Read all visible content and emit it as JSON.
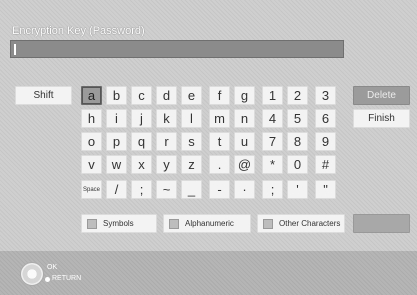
{
  "title": "Encryption Key (Password)",
  "keys": {
    "row1": [
      "a",
      "b",
      "c",
      "d",
      "e",
      "f",
      "g",
      "1",
      "2",
      "3"
    ],
    "row2": [
      "h",
      "i",
      "j",
      "k",
      "l",
      "m",
      "n",
      "4",
      "5",
      "6"
    ],
    "row3": [
      "o",
      "p",
      "q",
      "r",
      "s",
      "t",
      "u",
      "7",
      "8",
      "9"
    ],
    "row4": [
      "v",
      "w",
      "x",
      "y",
      "z",
      ".",
      "@",
      "*",
      "0",
      "#"
    ],
    "row5": [
      "Space",
      "/",
      ";",
      "~",
      "_",
      "-",
      "·",
      ";",
      "'",
      "\""
    ],
    "selected": "a"
  },
  "side": {
    "shift": "Shift",
    "delete": "Delete",
    "finish": "Finish"
  },
  "bottom": {
    "symbols": "Symbols",
    "alphanumeric": "Alphanumeric",
    "other": "Other Characters"
  },
  "footer": {
    "ok": "OK",
    "return": "RETURN"
  },
  "colors": {
    "background": "#cfcfcf",
    "key": "#f3f3f3",
    "selected_key": "#9a9a9a",
    "field": "#8b8b8b"
  }
}
